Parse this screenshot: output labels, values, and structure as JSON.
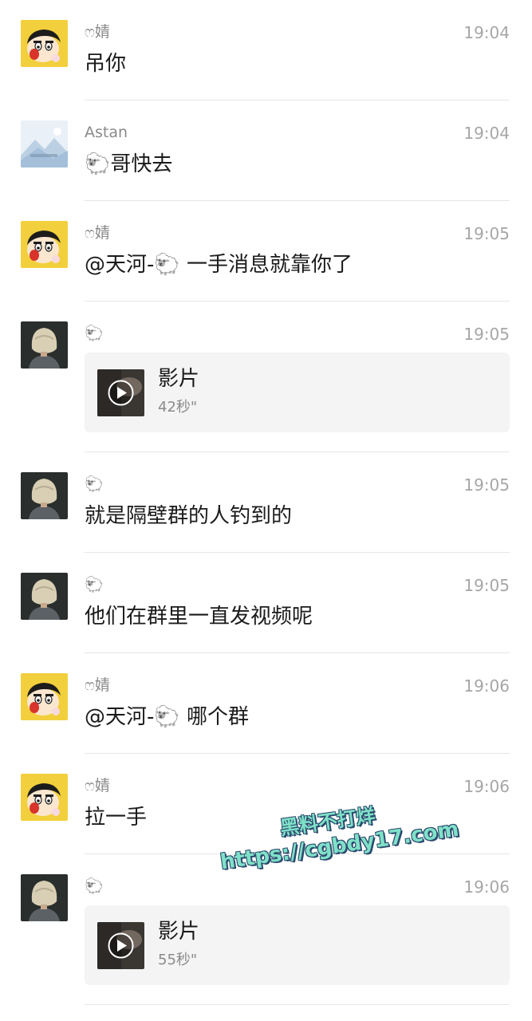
{
  "messages": [
    {
      "sender": "ෆ婧",
      "avatar": "crayon-shin-chan",
      "time": "19:04",
      "type": "text",
      "text": "吊你"
    },
    {
      "sender": "Astan",
      "avatar": "landscape",
      "time": "19:04",
      "type": "text",
      "text": "🐑哥快去"
    },
    {
      "sender": "ෆ婧",
      "avatar": "crayon-shin-chan",
      "time": "19:05",
      "type": "text",
      "text": "@天河-🐑 一手消息就靠你了"
    },
    {
      "sender": "🐑",
      "avatar": "blonde-bob",
      "time": "19:05",
      "type": "video",
      "title": "影片",
      "duration": "42秒\""
    },
    {
      "sender": "🐑",
      "avatar": "blonde-bob",
      "time": "19:05",
      "type": "text",
      "text": "就是隔壁群的人钓到的"
    },
    {
      "sender": "🐑",
      "avatar": "blonde-bob",
      "time": "19:05",
      "type": "text",
      "text": "他们在群里一直发视频呢"
    },
    {
      "sender": "ෆ婧",
      "avatar": "crayon-shin-chan",
      "time": "19:06",
      "type": "text",
      "text": "@天河-🐑 哪个群"
    },
    {
      "sender": "ෆ婧",
      "avatar": "crayon-shin-chan",
      "time": "19:06",
      "type": "text",
      "text": "拉一手"
    },
    {
      "sender": "🐑",
      "avatar": "blonde-bob",
      "time": "19:06",
      "type": "video",
      "title": "影片",
      "duration": "55秒\""
    }
  ],
  "watermark": {
    "line1": "黑料不打烊",
    "line2": "https://cgbdy17.com"
  },
  "colors": {
    "background": "#ffffff",
    "divider": "#e6e6e6",
    "card": "#f4f4f4",
    "watermark": "#7fe1c8"
  }
}
